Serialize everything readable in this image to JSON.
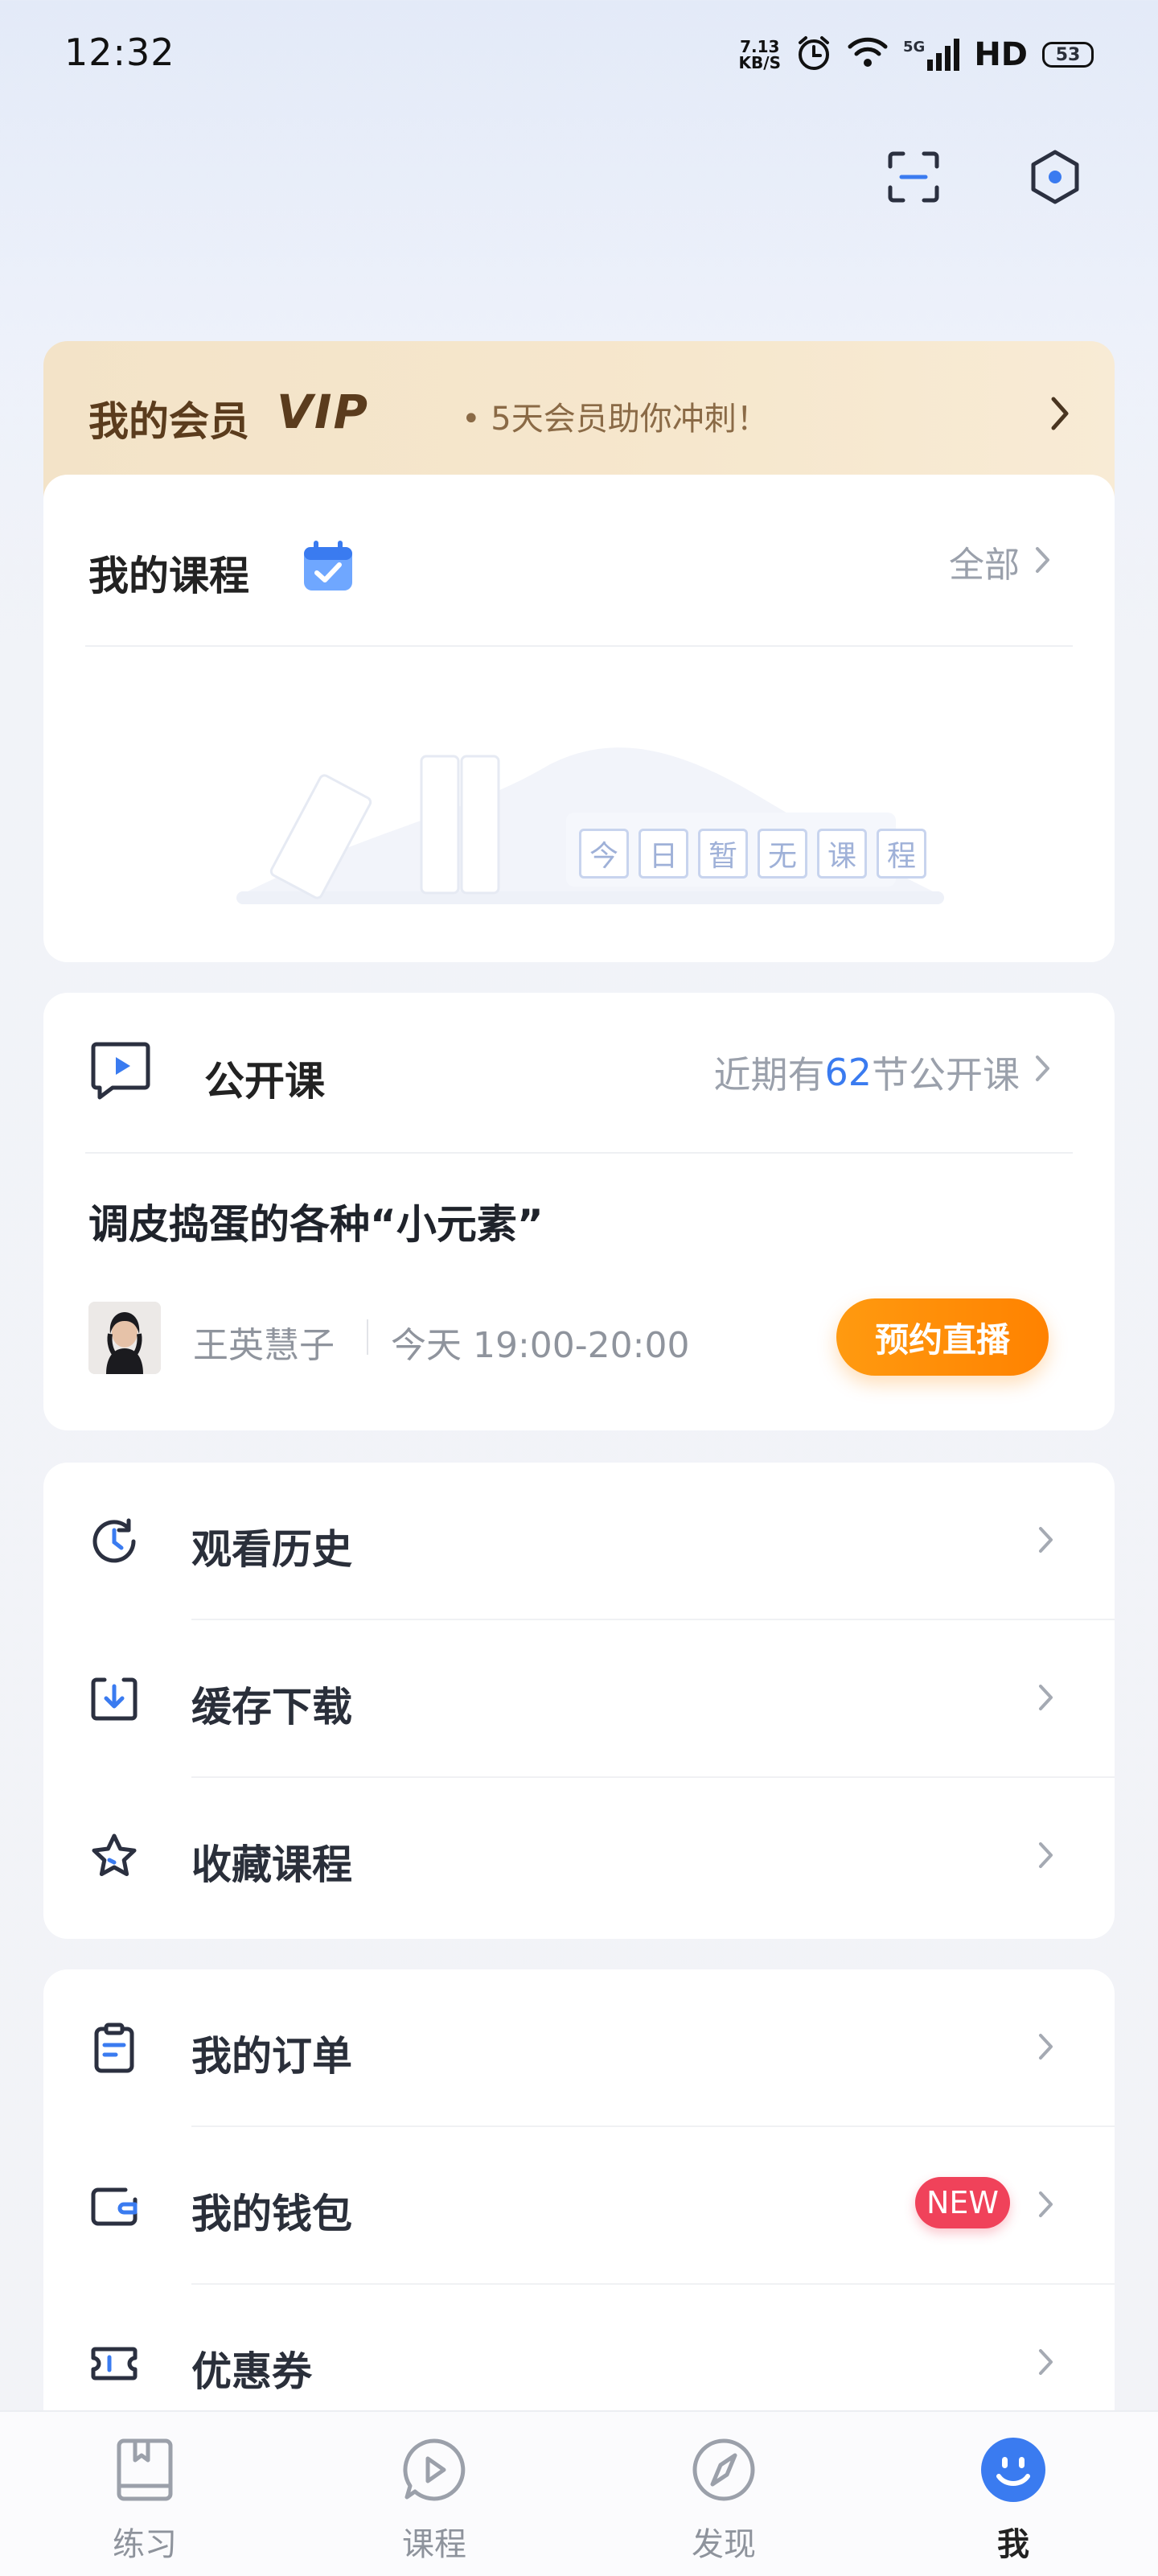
{
  "status_bar": {
    "time": "12:32",
    "net_speed_value": "7.13",
    "net_speed_unit": "KB/S",
    "signal_label": "5G",
    "hd_label": "HD",
    "battery": "53"
  },
  "top_actions": {
    "scan_icon": "scan-icon",
    "settings_icon": "hexagon-settings-icon"
  },
  "vip": {
    "title": "我的会员",
    "badge": "VIP",
    "desc": "• 5天会员助你冲刺！"
  },
  "courses": {
    "title": "我的课程",
    "all_label": "全部",
    "empty_chars": [
      "今",
      "日",
      "暂",
      "无",
      "课",
      "程"
    ]
  },
  "public_class": {
    "title": "公开课",
    "summary_prefix": "近期有",
    "summary_count": "62",
    "summary_suffix": "节公开课",
    "lesson_title": "调皮捣蛋的各种“小元素”",
    "teacher": "王英慧子",
    "time": "今天 19:00-20:00",
    "book_button": "预约直播"
  },
  "menu_group_1": [
    {
      "label": "观看历史",
      "icon": "clock-history-icon"
    },
    {
      "label": "缓存下载",
      "icon": "download-icon"
    },
    {
      "label": "收藏课程",
      "icon": "star-icon"
    }
  ],
  "menu_group_2": [
    {
      "label": "我的订单",
      "icon": "order-clipboard-icon"
    },
    {
      "label": "我的钱包",
      "icon": "wallet-icon",
      "badge": "NEW"
    },
    {
      "label": "优惠券",
      "icon": "coupon-icon"
    }
  ],
  "bottom_nav": [
    {
      "label": "练习",
      "icon": "book-icon",
      "active": false
    },
    {
      "label": "课程",
      "icon": "play-bubble-icon",
      "active": false
    },
    {
      "label": "发现",
      "icon": "compass-icon",
      "active": false
    },
    {
      "label": "我",
      "icon": "smiley-icon",
      "active": true
    }
  ],
  "colors": {
    "accent_blue": "#3a7bf0",
    "orange": "#ff8a00",
    "new_red": "#f0425a",
    "vip_brown": "#5b3c1d"
  }
}
